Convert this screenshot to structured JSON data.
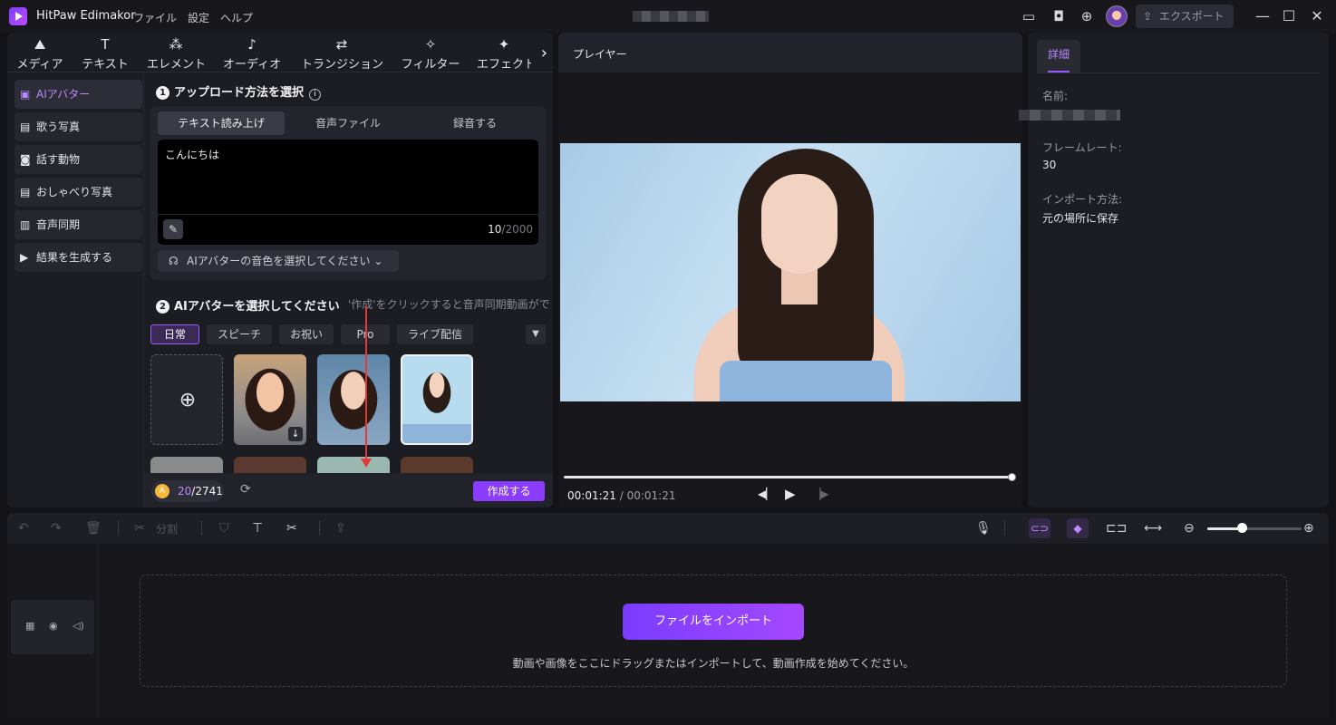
{
  "titlebar": {
    "app_name": "HitPaw Edimakor",
    "menus": [
      "ファイル",
      "設定",
      "ヘルプ"
    ],
    "export_label": "エクスポート"
  },
  "toolbar_tabs": [
    {
      "label": "メディア",
      "icon": "media-icon"
    },
    {
      "label": "テキスト",
      "icon": "text-icon"
    },
    {
      "label": "エレメント",
      "icon": "element-icon"
    },
    {
      "label": "オーディオ",
      "icon": "audio-icon"
    },
    {
      "label": "トランジション",
      "icon": "transition-icon"
    },
    {
      "label": "フィルター",
      "icon": "filter-icon"
    },
    {
      "label": "エフェクト",
      "icon": "effect-icon"
    }
  ],
  "sidebar": {
    "items": [
      {
        "label": "AIアバター",
        "active": true
      },
      {
        "label": "歌う写真"
      },
      {
        "label": "話す動物"
      },
      {
        "label": "おしゃべり写真"
      },
      {
        "label": "音声同期"
      },
      {
        "label": "結果を生成する"
      }
    ]
  },
  "step1": {
    "title": "アップロード方法を選択",
    "modes": [
      "テキスト読み上げ",
      "音声ファイル",
      "録音する"
    ],
    "text_value": "こんにちは",
    "char_count": "10",
    "char_max": "/2000",
    "voice_select": "AIアバターの音色を選択してください"
  },
  "step2": {
    "title": "AIアバターを選択してください",
    "hint": "'作成'をクリックすると音声同期動画がで",
    "categories": [
      "日常",
      "スピーチ",
      "お祝い",
      "Pro",
      "ライブ配信"
    ],
    "selected_category": "日常"
  },
  "footer": {
    "credits_used": "20",
    "credits_total": "/2741",
    "generate_label": "作成する"
  },
  "player": {
    "title": "プレイヤー",
    "current_time": "00:01:21",
    "separator": " / ",
    "duration": "00:01:21",
    "progress": 1.0
  },
  "details": {
    "tab": "詳細",
    "name_label": "名前:",
    "framerate_label": "フレームレート:",
    "framerate_value": "30",
    "import_label": "インポート方法:",
    "import_value": "元の場所に保存"
  },
  "timeline_toolbar": {
    "split_label": "分割",
    "zoom_level": 0.33
  },
  "timeline": {
    "import_button": "ファイルをインポート",
    "hint": "動画や画像をここにドラッグまたはインポートして、動画作成を始めてください。"
  },
  "colors": {
    "accent": "#8a3cff",
    "active_text": "#b98bff",
    "panel": "#1c1c23",
    "background": "#121217"
  }
}
